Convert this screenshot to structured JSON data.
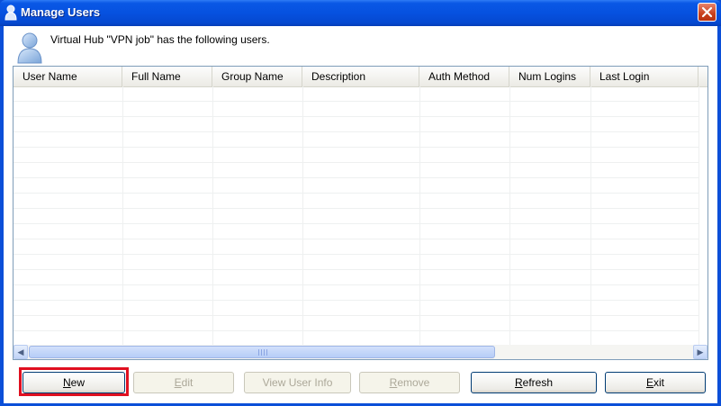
{
  "window": {
    "title": "Manage Users"
  },
  "header": {
    "text": "Virtual Hub \"VPN job\" has the following users."
  },
  "table": {
    "columns": [
      "User Name",
      "Full Name",
      "Group Name",
      "Description",
      "Auth Method",
      "Num Logins",
      "Last Login"
    ],
    "rows": []
  },
  "buttons": {
    "new": {
      "label": "New",
      "mnemonic": "N",
      "rest": "ew",
      "enabled": true
    },
    "edit": {
      "label": "Edit",
      "mnemonic": "E",
      "rest": "dit",
      "enabled": false
    },
    "view_info": {
      "label": "View User Info",
      "mnemonic": "",
      "rest": "View User Info",
      "enabled": false
    },
    "remove": {
      "label": "Remove",
      "mnemonic": "R",
      "rest": "emove",
      "enabled": false
    },
    "refresh": {
      "label": "Refresh",
      "mnemonic": "R",
      "rest": "efresh",
      "enabled": true
    },
    "exit": {
      "label": "Exit",
      "mnemonic": "E",
      "rest": "xit",
      "enabled": true
    }
  },
  "colors": {
    "titlebar": "#0651df",
    "highlight": "#e01020"
  },
  "icons": [
    "user-icon",
    "close-icon",
    "scroll-left-icon",
    "scroll-right-icon"
  ]
}
